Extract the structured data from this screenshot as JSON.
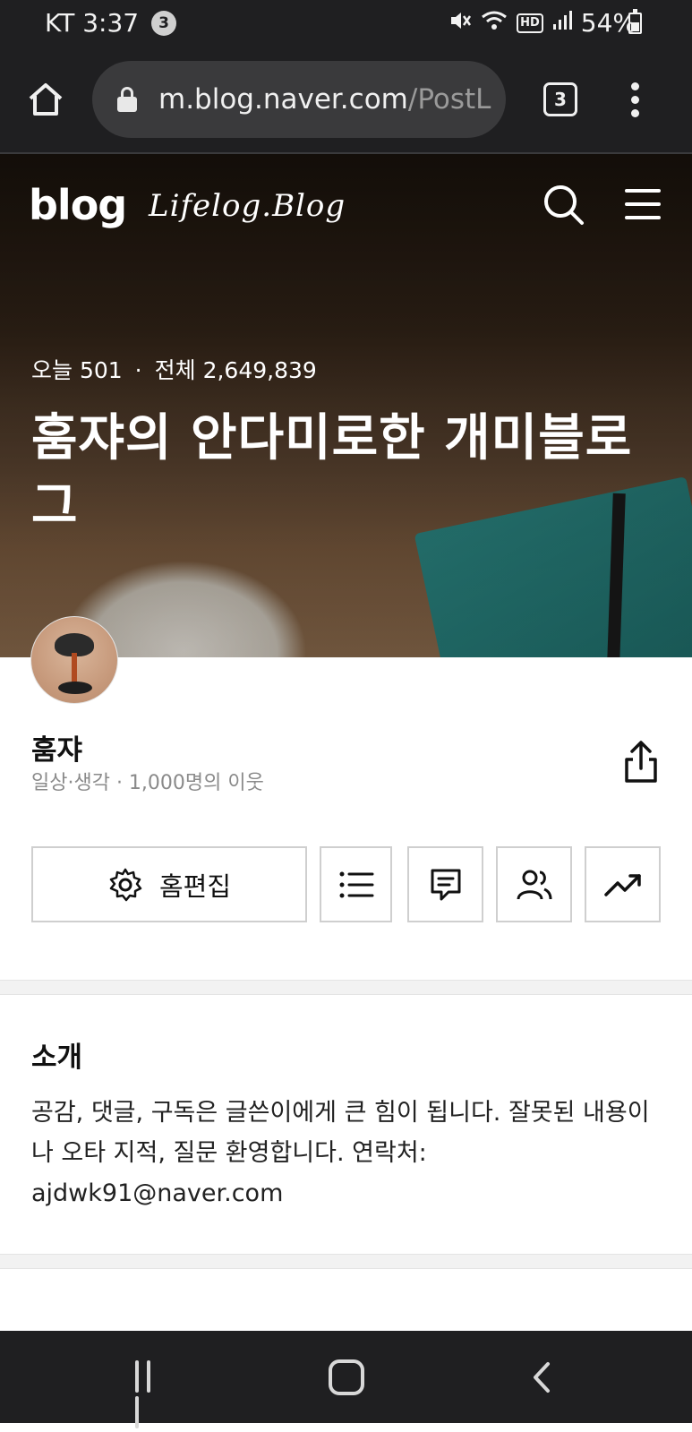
{
  "status_bar": {
    "carrier_time": "KT 3:37",
    "notification_count": "3",
    "hd_label": "HD",
    "battery": "54%"
  },
  "browser": {
    "url_host": "m.blog.naver.com",
    "url_path": "/PostL",
    "tab_count": "3"
  },
  "hero": {
    "blog_logo": "blog",
    "lifelog_logo": "Lifelog.Blog",
    "today_label": "오늘 501",
    "dot": "·",
    "total_label": "전체 2,649,839",
    "blog_title": "훔쟈의 안다미로한 개미블로그"
  },
  "profile": {
    "name": "훔쟈",
    "subtitle": "일상·생각 · 1,000명의 이웃"
  },
  "actions": {
    "home_edit_label": "홈편집"
  },
  "intro": {
    "heading": "소개",
    "text": "공감, 댓글, 구독은 글쓴이에게 큰 힘이 됩니다. 잘못된 내용이나 오타 지적, 질문 환영합니다. 연락처: ajdwk91@naver.com"
  }
}
